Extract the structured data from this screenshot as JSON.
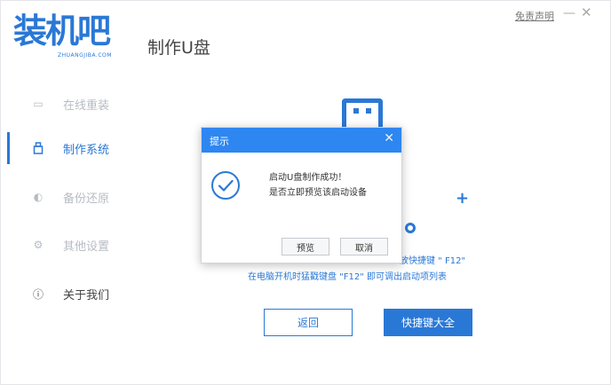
{
  "header": {
    "logo_text": "装机吧",
    "logo_subtext": "ZHUANGJIBA.COM",
    "app_title": "制作U盘",
    "disclaimer": "免责声明",
    "minimize_glyph": "—",
    "close_glyph": "✕"
  },
  "sidebar": {
    "items": [
      {
        "label": "在线重装",
        "icon": "monitor-icon",
        "glyph": "▭",
        "state": "inactive"
      },
      {
        "label": "制作系统",
        "icon": "usb-drive-icon",
        "glyph": "⌂",
        "state": "active"
      },
      {
        "label": "备份还原",
        "icon": "backup-icon",
        "glyph": "◐",
        "state": "inactive"
      },
      {
        "label": "其他设置",
        "icon": "settings-icon",
        "glyph": "⚙",
        "state": "inactive"
      },
      {
        "label": "关于我们",
        "icon": "info-icon",
        "glyph": "ⓘ",
        "state": "dark"
      }
    ]
  },
  "main": {
    "plus_glyph": "+",
    "hint_line1": "放快捷键 \" F12\"",
    "hint_line2": "在电脑开机时猛戳键盘 \"F12\" 即可调出启动项列表",
    "back_button": "返回",
    "shortcuts_button": "快捷键大全"
  },
  "dialog": {
    "title": "提示",
    "close_glyph": "✕",
    "message_line1": "启动U盘制作成功！",
    "message_line2": "是否立即预览该启动设备",
    "preview_button": "预览",
    "cancel_button": "取消"
  },
  "colors": {
    "accent": "#2a78d6",
    "dialog_header": "#2e86f0",
    "inactive_nav": "#b7bcc3"
  }
}
